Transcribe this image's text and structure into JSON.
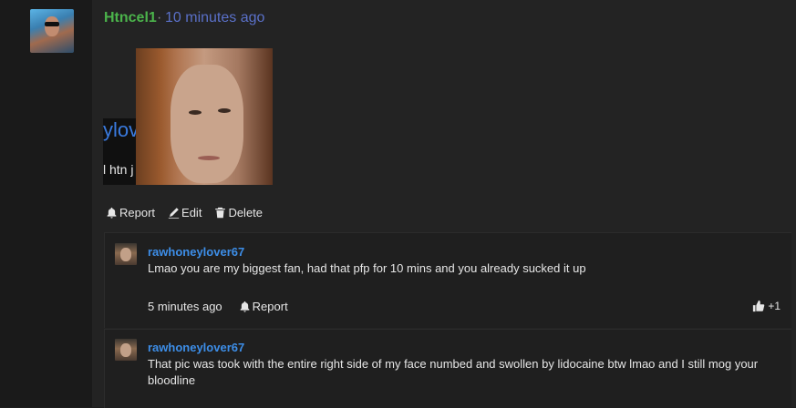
{
  "post": {
    "username": "Htncel1",
    "separator": "·",
    "time": "10 minutes ago",
    "embed_text_top": "ylov",
    "embed_text_bottom": "l htn j",
    "actions": {
      "report": "Report",
      "edit": "Edit",
      "delete": "Delete"
    }
  },
  "replies": [
    {
      "username": "rawhoneylover67",
      "text": "Lmao you are my biggest fan, had that pfp for 10 mins and you already sucked it up",
      "time": "5 minutes ago",
      "report": "Report",
      "likes": "+1"
    },
    {
      "username": "rawhoneylover67",
      "text": "That pic was took with the entire right side of my face numbed and swollen by lidocaine btw lmao and I still mog your bloodline"
    }
  ],
  "colors": {
    "username_main": "#4bb34b",
    "time_main": "#5a70c8",
    "reply_username": "#3d8ee8",
    "background": "#1e1e1e"
  },
  "icons": [
    "bell-icon",
    "pencil-icon",
    "trash-icon",
    "thumbs-up-icon"
  ]
}
